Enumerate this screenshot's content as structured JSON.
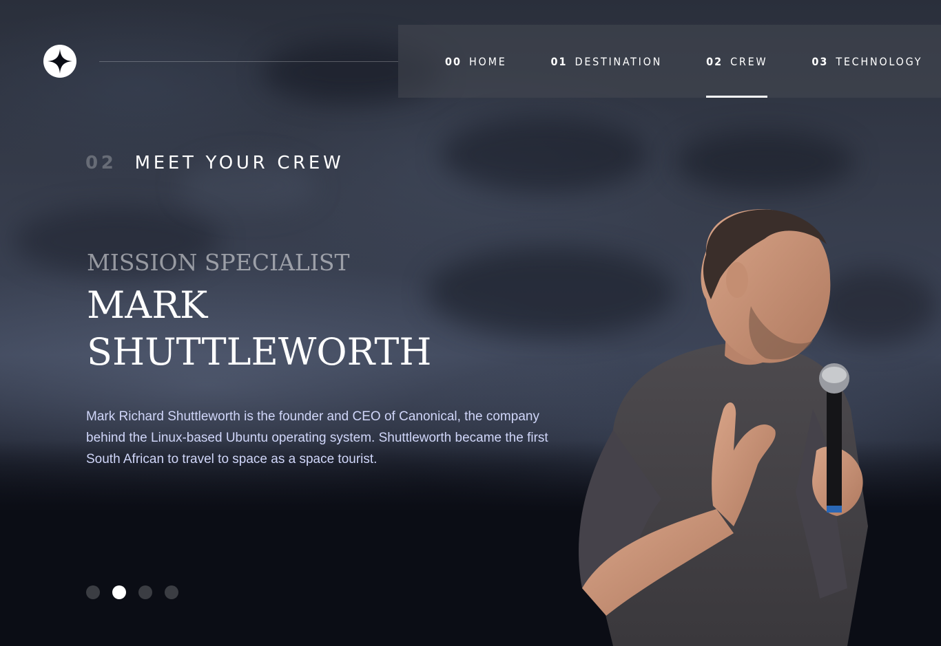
{
  "header": {
    "logo_icon": "star-logo-icon"
  },
  "nav": {
    "items": [
      {
        "num": "00",
        "label": "HOME"
      },
      {
        "num": "01",
        "label": "DESTINATION"
      },
      {
        "num": "02",
        "label": "CREW"
      },
      {
        "num": "03",
        "label": "TECHNOLOGY"
      }
    ],
    "active_index": 2
  },
  "page": {
    "eyebrow_num": "02",
    "eyebrow_text": "MEET YOUR CREW"
  },
  "crew": {
    "role": "MISSION SPECIALIST",
    "name_line1": "MARK",
    "name_line2": "SHUTTLEWORTH",
    "bio": "Mark Richard Shuttleworth is the founder and CEO of Canonical, the company behind the Linux-based Ubuntu operating system. Shuttleworth became the first South African to travel to space as a space tourist."
  },
  "slider": {
    "count": 4,
    "active_index": 1
  },
  "colors": {
    "bio_text": "#d0d6f9",
    "background_dark": "#0b0d15"
  }
}
